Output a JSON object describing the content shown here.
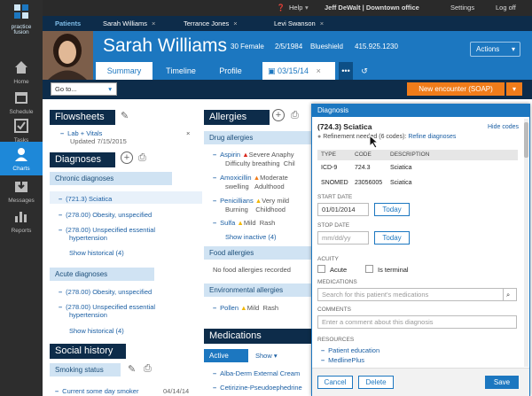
{
  "brand": {
    "line1": "practice",
    "line2": "fusion"
  },
  "nav": [
    {
      "label": "Home",
      "icon": "home-icon"
    },
    {
      "label": "Schedule",
      "icon": "calendar-icon"
    },
    {
      "label": "Tasks",
      "icon": "check-icon"
    },
    {
      "label": "Charts",
      "icon": "person-icon",
      "active": true
    },
    {
      "label": "Messages",
      "icon": "inbox-icon"
    },
    {
      "label": "Reports",
      "icon": "bar-chart-icon"
    }
  ],
  "topbar": {
    "help": "Help",
    "user": "Jeff DeWalt | Downtown office",
    "settings": "Settings",
    "logoff": "Log off"
  },
  "tabs": {
    "patients": "Patients",
    "list": [
      "Sarah Williams",
      "Terrance Jones",
      "Levi Swanson"
    ],
    "close": "×"
  },
  "patient": {
    "name": "Sarah Williams",
    "agesex": "30 Female",
    "dob": "2/5/1984",
    "insurance": "Blueshield",
    "phone": "415.925.1230"
  },
  "header": {
    "actions": "Actions",
    "tabs": [
      "Summary",
      "Timeline",
      "Profile"
    ],
    "encounter_date": "03/15/14",
    "more": "•••"
  },
  "toolbar": {
    "goto": "Go to...",
    "new_encounter": "New encounter (SOAP)"
  },
  "flowsheets": {
    "title": "Flowsheets",
    "item": "Lab + Vitals",
    "updated": "Updated 7/15/2015"
  },
  "diagnoses": {
    "title": "Diagnoses",
    "chronic_title": "Chronic diagnoses",
    "chronic": [
      "(721.3) Sciatica",
      "(278.00) Obesity, unspecified",
      "(278.00) Unspecified essential",
      "hypertension"
    ],
    "show_historical": "Show historical (4)",
    "acute_title": "Acute diagnoses",
    "acute": [
      "(278.00) Obesity, unspecified",
      "(278.00) Unspecified essential",
      "hypertension"
    ],
    "show_historical_acute": "Show historical (4)"
  },
  "social": {
    "title": "Social history",
    "smoking_title": "Smoking status",
    "smoking": "Current some day smoker",
    "smoking_date": "04/14/14"
  },
  "allergies": {
    "title": "Allergies",
    "drug_title": "Drug allergies",
    "drug": [
      {
        "name": "Aspirin",
        "severity": "Severe",
        "reaction": "Anaphy",
        "line2a": "Difficulty breathing",
        "line2b": "Chil"
      },
      {
        "name": "Amoxicillin",
        "severity": "Moderate",
        "reaction": "",
        "line2a": "swelling",
        "line2b": "Adulthood"
      },
      {
        "name": "Penicillians",
        "severity": "Very mild",
        "reaction": "",
        "line2a": "Burning",
        "line2b": "Childhood"
      },
      {
        "name": "Sulfa",
        "severity": "Mild",
        "reaction": "Rash",
        "line2a": "",
        "line2b": ""
      }
    ],
    "show_inactive": "Show inactive (4)",
    "food_title": "Food allergies",
    "food_empty": "No food allergies recorded",
    "env_title": "Environmental allergies",
    "env": {
      "name": "Pollen",
      "severity": "Mild",
      "reaction": "Rash"
    }
  },
  "medications": {
    "title": "Medications",
    "filter": "Active",
    "show": "Show",
    "items": [
      "Alba-Derm External Cream",
      "Cetirizine-Pseudoephedrine"
    ]
  },
  "modal": {
    "title": "Diagnosis",
    "diagnosis": "(724.3) Sciatica",
    "hide_codes": "Hide codes",
    "refinement": "Refinement needed (6 codes):",
    "refine_link": "Refine diagnoses",
    "code_headers": [
      "TYPE",
      "CODE",
      "DESCRIPTION"
    ],
    "codes": [
      {
        "type": "ICD-9",
        "code": "724.3",
        "desc": "Sciatica"
      },
      {
        "type": "SNOMED",
        "code": "23056005",
        "desc": "Sciatica"
      }
    ],
    "start_label": "START DATE",
    "start_value": "01/01/2014",
    "today": "Today",
    "stop_label": "STOP DATE",
    "stop_placeholder": "mm/dd/yy",
    "acuity_label": "ACUITY",
    "acute": "Acute",
    "terminal": "Is terminal",
    "medications_label": "MEDICATIONS",
    "medications_placeholder": "Search for this patient's medications",
    "comments_label": "COMMENTS",
    "comments_placeholder": "Enter a comment about this diagnosis",
    "resources_label": "RESOURCES",
    "resources": [
      "Patient education",
      "MedlinePlus"
    ],
    "cancel": "Cancel",
    "delete": "Delete",
    "save": "Save"
  },
  "colors": {
    "brand_blue": "#1c77c0",
    "navy": "#0d2c4a",
    "orange": "#f07c1a",
    "severe": "#d9261c",
    "moderate": "#f07c1a",
    "mild": "#f2b705"
  }
}
